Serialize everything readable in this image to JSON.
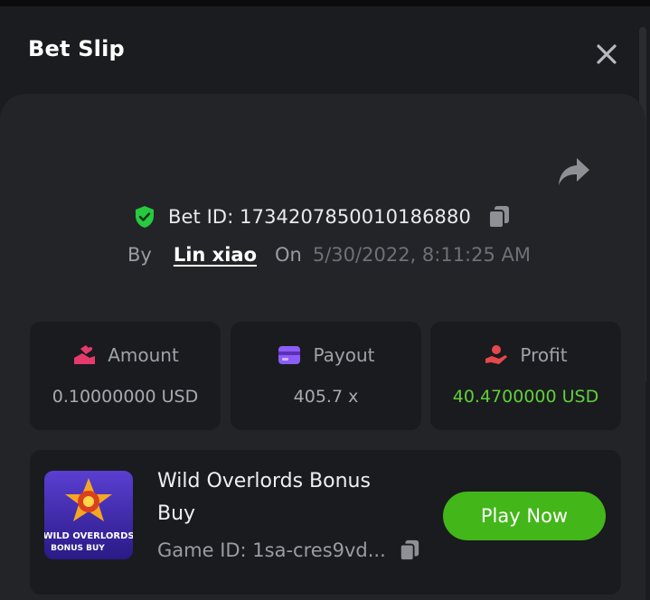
{
  "header": {
    "title": "Bet Slip"
  },
  "bet": {
    "id_text": "Bet ID: 1734207850010186880",
    "by_label": "By",
    "username": "Lin xiao",
    "on_label": "On",
    "datetime": "5/30/2022, 8:11:25 AM"
  },
  "stats": {
    "amount": {
      "label": "Amount",
      "value": "0.10000000 USD",
      "icon": "coins-hand-icon"
    },
    "payout": {
      "label": "Payout",
      "value": "405.7 x",
      "icon": "card-icon"
    },
    "profit": {
      "label": "Profit",
      "value": "40.4700000 USD",
      "icon": "hand-profit-icon"
    }
  },
  "game": {
    "name": "Wild Overlords Bonus Buy",
    "id_text": "Game ID: 1sa-cres9vd...",
    "thumb_text_line1": "WILD OVERLORDS",
    "thumb_text_line2": "BONUS BUY",
    "play_label": "Play Now"
  },
  "colors": {
    "accent_green": "#43b61a",
    "profit_green": "#5fd03a",
    "amount_icon": "#e63a6b",
    "payout_icon": "#8b5cf6",
    "profit_icon": "#e5484d",
    "shield": "#27c93f"
  }
}
